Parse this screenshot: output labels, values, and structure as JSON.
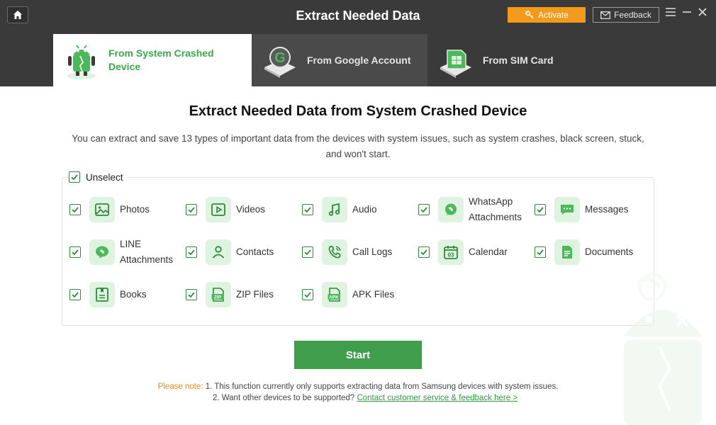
{
  "header": {
    "title": "Extract Needed Data",
    "activate_label": "Activate",
    "feedback_label": "Feedback",
    "accent_color": "#f39a1c",
    "home_icon": "home-icon",
    "menu_icon": "menu-icon",
    "minimize_icon": "minimize-icon",
    "close_icon": "close-icon"
  },
  "tabs": [
    {
      "label": "From System Crashed Device",
      "active": true,
      "icon": "crashed-android-icon"
    },
    {
      "label": "From Google Account",
      "active": false,
      "icon": "google-account-icon"
    },
    {
      "label": "From SIM Card",
      "active": false,
      "icon": "sim-card-icon"
    }
  ],
  "main": {
    "title": "Extract Needed Data from System Crashed Device",
    "description": "You can extract and save 13 types of important data from the devices with system issues, such as system crashes, black screen, stuck, and won't start.",
    "unselect_label": "Unselect",
    "start_label": "Start",
    "brand_color": "#3f9d4b"
  },
  "data_types": [
    {
      "label": "Photos",
      "icon": "photos-icon",
      "checked": true
    },
    {
      "label": "Videos",
      "icon": "videos-icon",
      "checked": true
    },
    {
      "label": "Audio",
      "icon": "audio-icon",
      "checked": true
    },
    {
      "label": "WhatsApp Attachments",
      "icon": "whatsapp-icon",
      "checked": true
    },
    {
      "label": "Messages",
      "icon": "messages-icon",
      "checked": true
    },
    {
      "label": "LINE Attachments",
      "icon": "line-icon",
      "checked": true
    },
    {
      "label": "Contacts",
      "icon": "contacts-icon",
      "checked": true
    },
    {
      "label": "Call Logs",
      "icon": "call-logs-icon",
      "checked": true
    },
    {
      "label": "Calendar",
      "icon": "calendar-icon",
      "checked": true
    },
    {
      "label": "Documents",
      "icon": "documents-icon",
      "checked": true
    },
    {
      "label": "Books",
      "icon": "books-icon",
      "checked": true
    },
    {
      "label": "ZIP Files",
      "icon": "zip-icon",
      "checked": true
    },
    {
      "label": "APK Files",
      "icon": "apk-icon",
      "checked": true
    }
  ],
  "note": {
    "label": "Please note:",
    "line1": "1. This function currently only supports extracting data from Samsung devices with system issues.",
    "line2_text": "2. Want other devices to be supported?",
    "line2_link": "Contact customer service & feedback here >"
  }
}
